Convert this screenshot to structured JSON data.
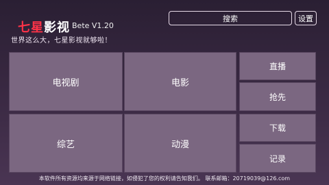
{
  "brand": {
    "title_part1": "七星",
    "title_part2": "影视",
    "version": "Bete V1.20",
    "slogan": "世界这么大，七星影视就够啦！"
  },
  "header": {
    "search_label": "搜索",
    "settings_label": "设置"
  },
  "main": {
    "tiles": [
      {
        "label": "电视剧"
      },
      {
        "label": "电影"
      },
      {
        "label": "综艺"
      },
      {
        "label": "动漫"
      }
    ]
  },
  "sidebar": {
    "items": [
      {
        "label": "直播"
      },
      {
        "label": "抢先"
      },
      {
        "label": "下载"
      },
      {
        "label": "记录"
      }
    ]
  },
  "footer": {
    "text": "本软件所有资源均来源于网络链接，如侵犯了您的权利请告知我们。 联系邮箱：20719039@126.com"
  }
}
